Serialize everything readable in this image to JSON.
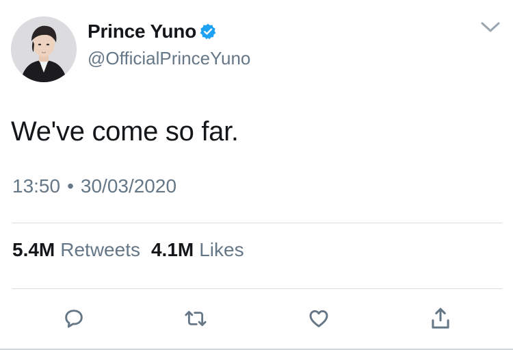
{
  "tweet": {
    "display_name": "Prince Yuno",
    "handle": "@OfficialPrinceYuno",
    "verified": true,
    "text": "We've come so far.",
    "time": "13:50",
    "separator": "•",
    "date": "30/03/2020",
    "retweets_count": "5.4M",
    "retweets_label": "Retweets",
    "likes_count": "4.1M",
    "likes_label": "Likes"
  },
  "colors": {
    "text_primary": "#14171a",
    "text_secondary": "#657786",
    "verified_blue": "#1da1f2",
    "divider": "#d7dde2"
  },
  "icons": {
    "more": "chevron-down-icon",
    "verified": "verified-badge-icon",
    "reply": "reply-icon",
    "retweet": "retweet-icon",
    "like": "heart-icon",
    "share": "share-icon"
  }
}
